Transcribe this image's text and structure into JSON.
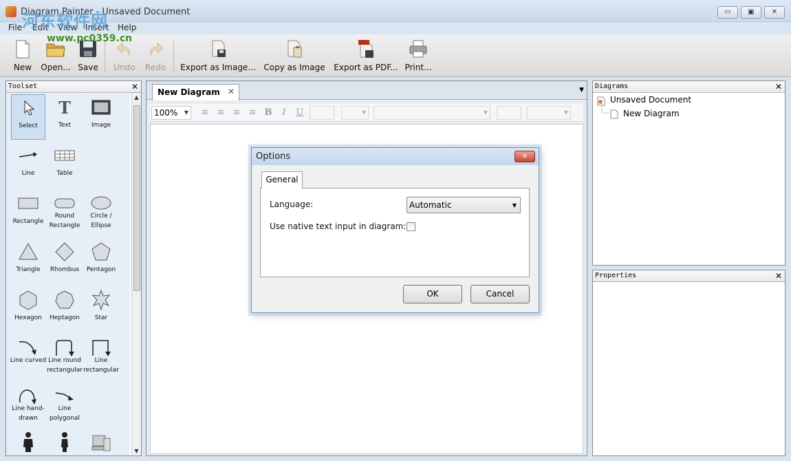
{
  "window": {
    "title": "Diagram Painter - Unsaved Document",
    "minimize": "▭",
    "maximize": "▣",
    "close": "✕"
  },
  "watermark": {
    "line1": "河东软件网",
    "line2": "www.pc0359.cn"
  },
  "menu": [
    "File",
    "Edit",
    "View",
    "Insert",
    "Help"
  ],
  "toolbar": {
    "new": "New",
    "open": "Open...",
    "save": "Save",
    "undo": "Undo",
    "redo": "Redo",
    "export_image": "Export as Image...",
    "copy_image": "Copy as Image",
    "export_pdf": "Export as PDF...",
    "print": "Print..."
  },
  "toolset": {
    "title": "Toolset",
    "close": "✕",
    "tools": {
      "select": "Select",
      "text": "Text",
      "image": "Image",
      "line": "Line",
      "table": "Table",
      "rectangle": "Rectangle",
      "round_rectangle": "Round Rectangle",
      "ellipse": "Circle / Ellipse",
      "triangle": "Triangle",
      "rhombus": "Rhombus",
      "pentagon": "Pentagon",
      "hexagon": "Hexagon",
      "heptagon": "Heptagon",
      "star": "Star",
      "line_curved": "Line curved",
      "line_round_rect": "Line round rectangular",
      "line_rect": "Line rectangular",
      "line_hand": "Line hand-drawn",
      "line_poly": "Line polygonal"
    }
  },
  "document": {
    "tab_label": "New Diagram",
    "tab_close": "✕",
    "zoom": "100%",
    "format": {
      "align_left": "≡",
      "align_center": "≡",
      "align_right": "≡",
      "justify": "≡",
      "bold": "B",
      "italic": "I",
      "underline": "U"
    }
  },
  "dialog": {
    "title": "Options",
    "close": "✕",
    "tab": "General",
    "language_label": "Language:",
    "language_value": "Automatic",
    "native_input_label": "Use native text input in diagram:",
    "native_input_checked": false,
    "ok": "OK",
    "cancel": "Cancel"
  },
  "diagrams_panel": {
    "title": "Diagrams",
    "close": "✕",
    "root": "Unsaved Document",
    "child": "New Diagram"
  },
  "properties_panel": {
    "title": "Properties",
    "close": "✕"
  }
}
